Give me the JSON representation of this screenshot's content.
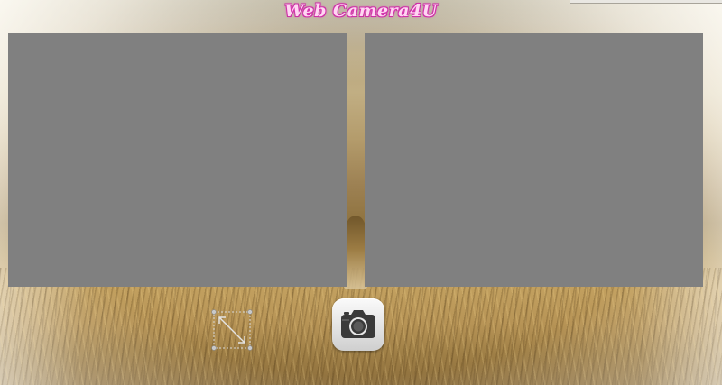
{
  "app": {
    "title": "Web Camera4U",
    "title_color": "#ff6ccf"
  },
  "panels": {
    "left": {
      "fill_color": "#808080"
    },
    "right": {
      "fill_color": "#808080"
    }
  },
  "controls": {
    "resize_icon": "resize-diagonal-icon",
    "capture_icon": "camera-icon"
  }
}
